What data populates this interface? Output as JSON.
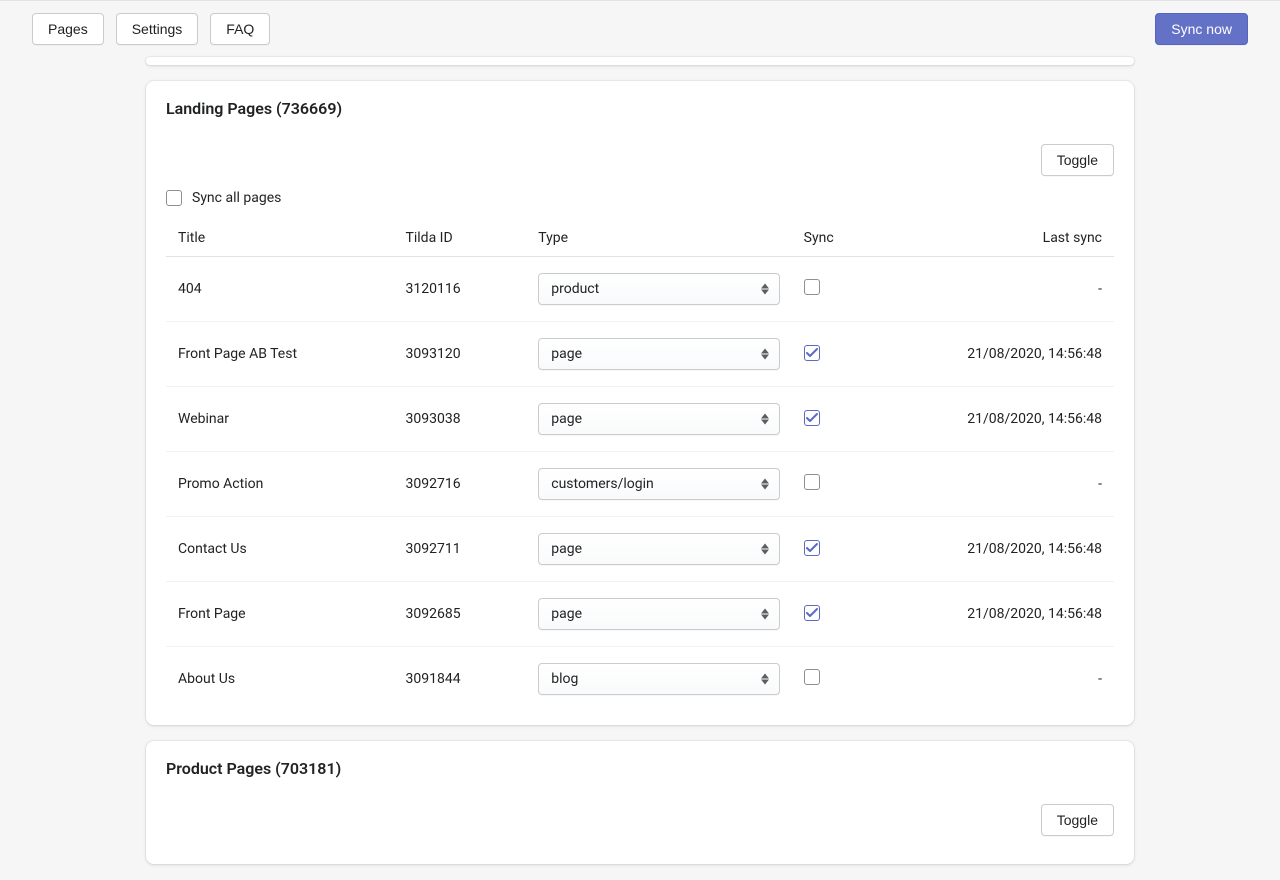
{
  "topbar": {
    "buttons": {
      "pages": "Pages",
      "settings": "Settings",
      "faq": "FAQ",
      "sync_now": "Sync now"
    }
  },
  "sections": {
    "landing": {
      "title": "Landing Pages (736669)",
      "toggle_label": "Toggle",
      "sync_all_label": "Sync all pages",
      "columns": {
        "title": "Title",
        "tilda_id": "Tilda ID",
        "type": "Type",
        "sync": "Sync",
        "last_sync": "Last sync"
      },
      "rows": [
        {
          "title": "404",
          "tilda_id": "3120116",
          "type": "product",
          "sync": false,
          "last_sync": "-"
        },
        {
          "title": "Front Page AB Test",
          "tilda_id": "3093120",
          "type": "page",
          "sync": true,
          "last_sync": "21/08/2020, 14:56:48"
        },
        {
          "title": "Webinar",
          "tilda_id": "3093038",
          "type": "page",
          "sync": true,
          "last_sync": "21/08/2020, 14:56:48"
        },
        {
          "title": "Promo Action",
          "tilda_id": "3092716",
          "type": "customers/login",
          "sync": false,
          "last_sync": "-"
        },
        {
          "title": "Contact Us",
          "tilda_id": "3092711",
          "type": "page",
          "sync": true,
          "last_sync": "21/08/2020, 14:56:48"
        },
        {
          "title": "Front Page",
          "tilda_id": "3092685",
          "type": "page",
          "sync": true,
          "last_sync": "21/08/2020, 14:56:48"
        },
        {
          "title": "About Us",
          "tilda_id": "3091844",
          "type": "blog",
          "sync": false,
          "last_sync": "-"
        }
      ]
    },
    "product": {
      "title": "Product Pages (703181)",
      "toggle_label": "Toggle"
    }
  }
}
